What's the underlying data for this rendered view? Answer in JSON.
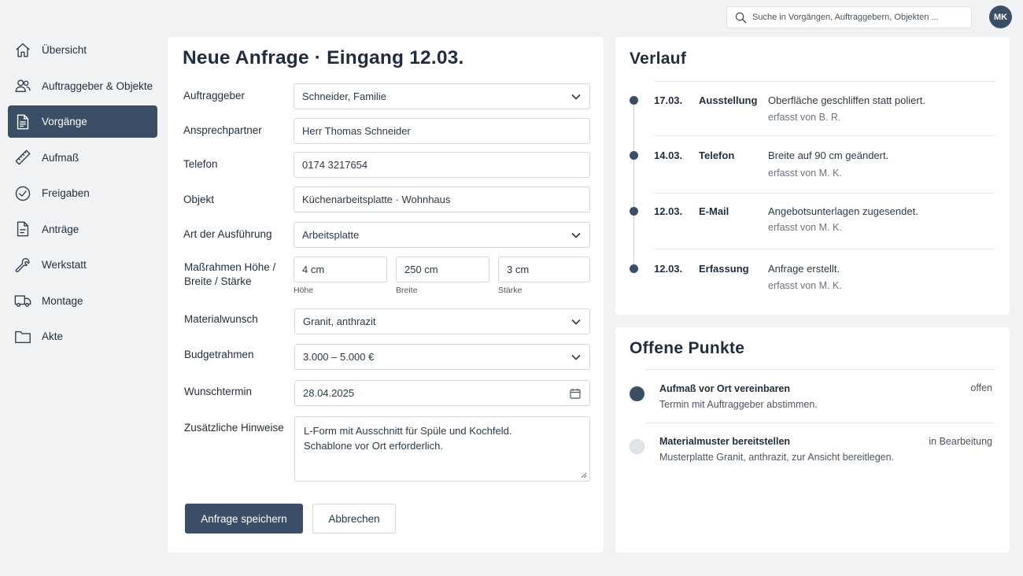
{
  "search": {
    "placeholder": "Suche in Vorgängen, Auftraggebern, Objekten ..."
  },
  "user": {
    "initials": "MK"
  },
  "sidebar": {
    "items": [
      {
        "label": "Übersicht",
        "icon": "home-icon",
        "active": false
      },
      {
        "label": "Auftraggeber & Objekte",
        "icon": "users-icon",
        "active": false
      },
      {
        "label": "Vorgänge",
        "icon": "document-icon",
        "active": true
      },
      {
        "label": "Aufmaß",
        "icon": "ruler-icon",
        "active": false
      },
      {
        "label": "Freigaben",
        "icon": "check-circle-icon",
        "active": false
      },
      {
        "label": "Anträge",
        "icon": "file-icon",
        "active": false
      },
      {
        "label": "Werkstatt",
        "icon": "wrench-icon",
        "active": false
      },
      {
        "label": "Montage",
        "icon": "truck-icon",
        "active": false
      },
      {
        "label": "Akte",
        "icon": "folder-icon",
        "active": false
      }
    ]
  },
  "form": {
    "title": "Neue Anfrage · Eingang 12.03.",
    "auftraggeber": {
      "label": "Auftraggeber",
      "value": "Schneider, Familie"
    },
    "ansprechpartner": {
      "label": "Ansprechpartner",
      "value": "Herr Thomas Schneider"
    },
    "telefon": {
      "label": "Telefon",
      "value": "0174 3217654"
    },
    "objekt": {
      "label": "Objekt",
      "value": "Küchenarbeitsplatte · Wohnhaus"
    },
    "ausfuehrung": {
      "label": "Art der Ausführung",
      "value": "Arbeitsplatte"
    },
    "masse": {
      "label_line1": "Maßrahmen Höhe /",
      "label_line2": "Breite / Stärke",
      "hoehe": {
        "value": "4 cm",
        "caption": "Höhe"
      },
      "breite": {
        "value": "250 cm",
        "caption": "Breite"
      },
      "staerke": {
        "value": "3 cm",
        "caption": "Stärke"
      }
    },
    "material": {
      "label": "Materialwunsch",
      "value": "Granit, anthrazit"
    },
    "budget": {
      "label": "Budgetrahmen",
      "value": "3.000 – 5.000 €"
    },
    "wunschtermin": {
      "label": "Wunschtermin",
      "value": "28.04.2025"
    },
    "hinweise": {
      "label": "Zusätzliche Hinweise",
      "line1": "L-Form mit Ausschnitt für Spüle und Kochfeld.",
      "line2": "Schablone vor Ort erforderlich."
    },
    "save_label": "Anfrage speichern",
    "cancel_label": "Abbrechen"
  },
  "verlauf": {
    "title": "Verlauf",
    "entries": [
      {
        "date": "17.03.",
        "type": "Ausstellung",
        "text": "Oberfläche geschliffen statt poliert.",
        "by": "erfasst von B. R."
      },
      {
        "date": "14.03.",
        "type": "Telefon",
        "text": "Breite auf 90 cm geändert.",
        "by": "erfasst von M. K."
      },
      {
        "date": "12.03.",
        "type": "E-Mail",
        "text": "Angebotsunterlagen zugesendet.",
        "by": "erfasst von M. K."
      },
      {
        "date": "12.03.",
        "type": "Erfassung",
        "text": "Anfrage erstellt.",
        "by": "erfasst von M. K."
      }
    ]
  },
  "offene_punkte": {
    "title": "Offene Punkte",
    "items": [
      {
        "title": "Aufmaß vor Ort vereinbaren",
        "desc": "Termin mit Auftraggeber abstimmen.",
        "status": "offen",
        "dot_color": "#3a4e66"
      },
      {
        "title": "Materialmuster bereitstellen",
        "desc": "Musterplatte Granit, anthrazit, zur Ansicht bereitlegen.",
        "status": "in Bearbeitung",
        "dot_color": "#e1e4e8"
      }
    ]
  }
}
